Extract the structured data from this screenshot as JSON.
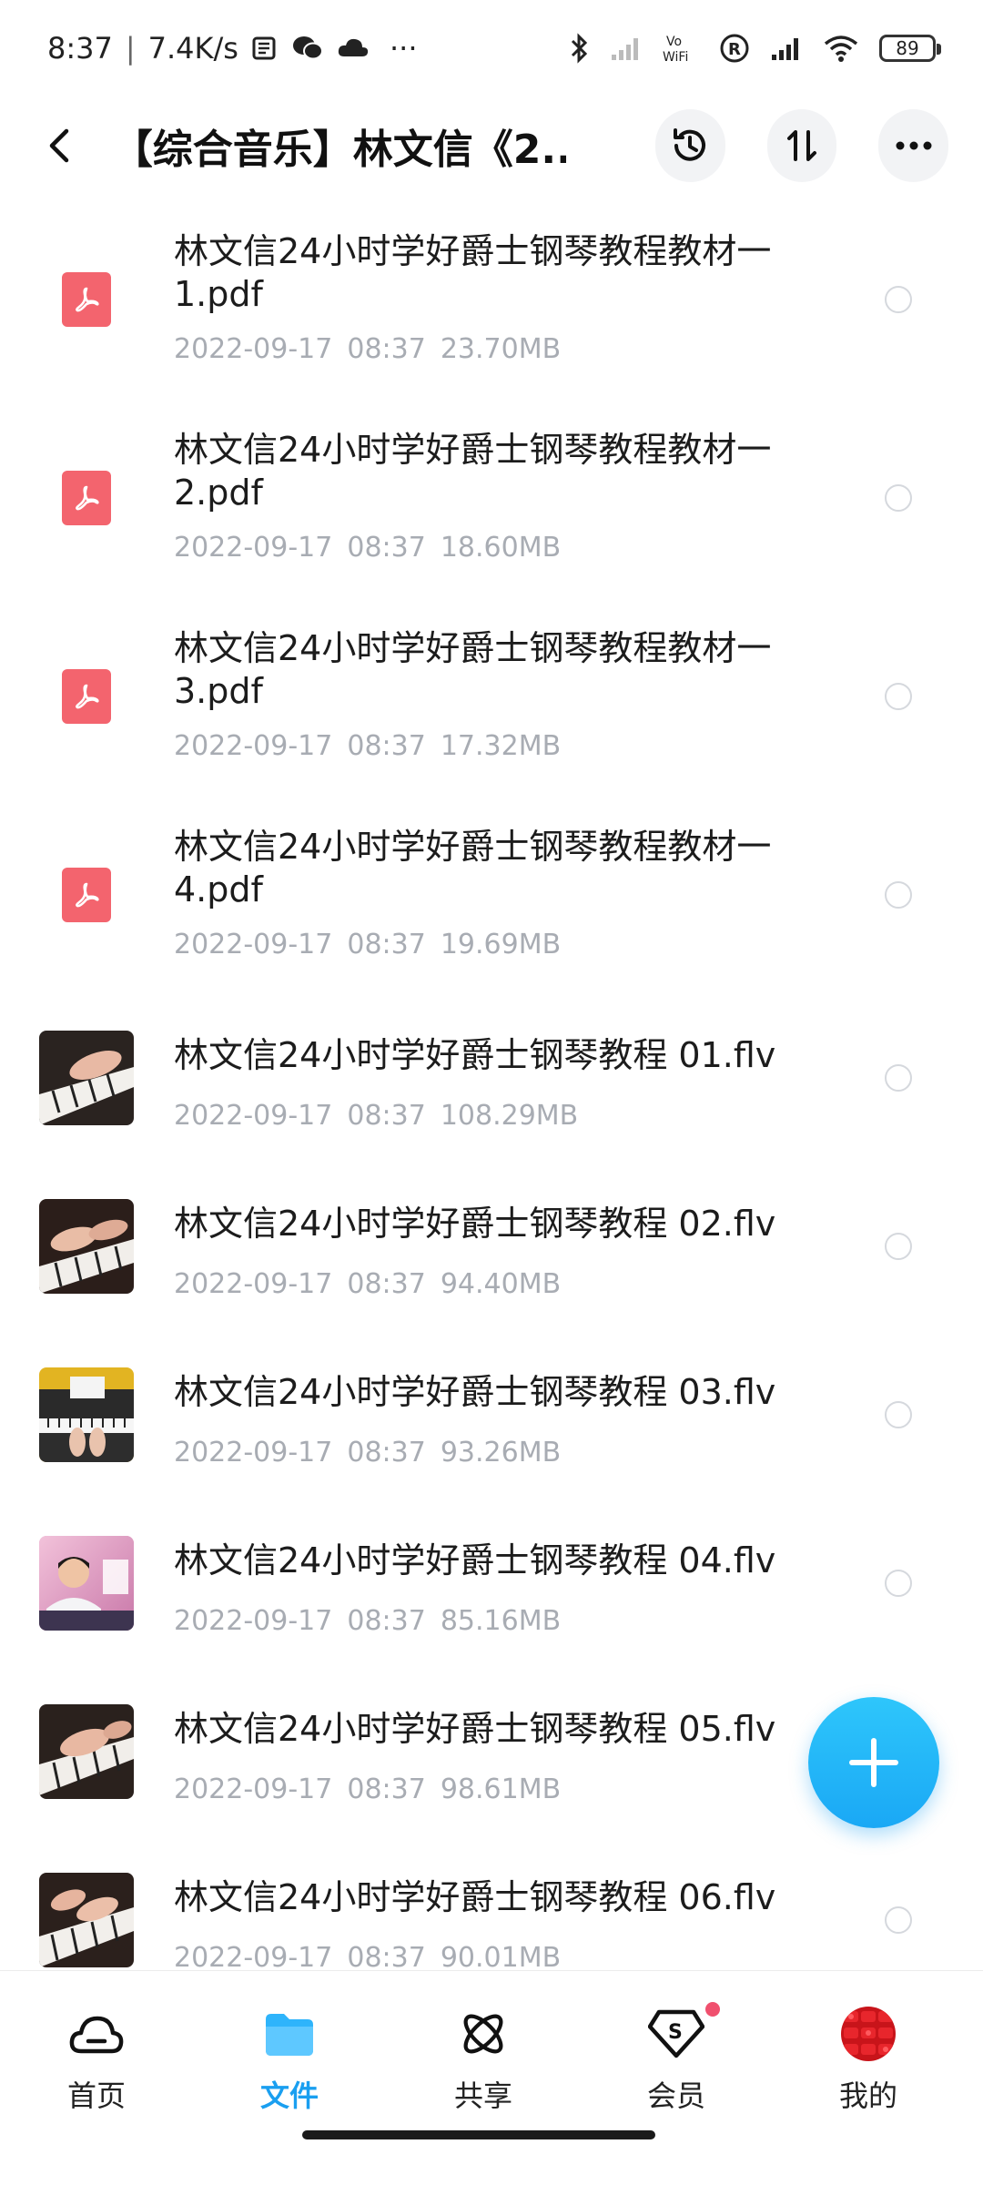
{
  "status_bar": {
    "time": "8:37",
    "separator": "|",
    "speed": "7.4K/s",
    "more": "···",
    "battery": "89"
  },
  "header": {
    "title": "【综合音乐】林文信《2..."
  },
  "files": [
    {
      "type": "pdf",
      "name": "林文信24小时学好爵士钢琴教程教材一1.pdf",
      "date": "2022-09-17",
      "time": "08:37",
      "size": "23.70MB"
    },
    {
      "type": "pdf",
      "name": "林文信24小时学好爵士钢琴教程教材一2.pdf",
      "date": "2022-09-17",
      "time": "08:37",
      "size": "18.60MB"
    },
    {
      "type": "pdf",
      "name": "林文信24小时学好爵士钢琴教程教材一3.pdf",
      "date": "2022-09-17",
      "time": "08:37",
      "size": "17.32MB"
    },
    {
      "type": "pdf",
      "name": "林文信24小时学好爵士钢琴教程教材一4.pdf",
      "date": "2022-09-17",
      "time": "08:37",
      "size": "19.69MB"
    },
    {
      "type": "video",
      "name": "林文信24小时学好爵士钢琴教程 01.flv",
      "date": "2022-09-17",
      "time": "08:37",
      "size": "108.29MB"
    },
    {
      "type": "video",
      "name": "林文信24小时学好爵士钢琴教程 02.flv",
      "date": "2022-09-17",
      "time": "08:37",
      "size": "94.40MB"
    },
    {
      "type": "video",
      "name": "林文信24小时学好爵士钢琴教程 03.flv",
      "date": "2022-09-17",
      "time": "08:37",
      "size": "93.26MB"
    },
    {
      "type": "video",
      "name": "林文信24小时学好爵士钢琴教程 04.flv",
      "date": "2022-09-17",
      "time": "08:37",
      "size": "85.16MB"
    },
    {
      "type": "video",
      "name": "林文信24小时学好爵士钢琴教程 05.flv",
      "date": "2022-09-17",
      "time": "08:37",
      "size": "98.61MB"
    },
    {
      "type": "video",
      "name": "林文信24小时学好爵士钢琴教程 06.flv",
      "date": "2022-09-17",
      "time": "08:37",
      "size": "90.01MB"
    }
  ],
  "bottom_nav": {
    "items": [
      {
        "label": "首页",
        "icon": "cloud-icon"
      },
      {
        "label": "文件",
        "icon": "folder-icon"
      },
      {
        "label": "共享",
        "icon": "atom-icon"
      },
      {
        "label": "会员",
        "icon": "diamond-s-icon"
      },
      {
        "label": "我的",
        "icon": "avatar"
      }
    ],
    "active": "文件"
  },
  "colors": {
    "accent": "#1a9ff0",
    "pdf": "#f3646e",
    "meta_text": "#a8acb3",
    "badge": "#f0506e"
  }
}
